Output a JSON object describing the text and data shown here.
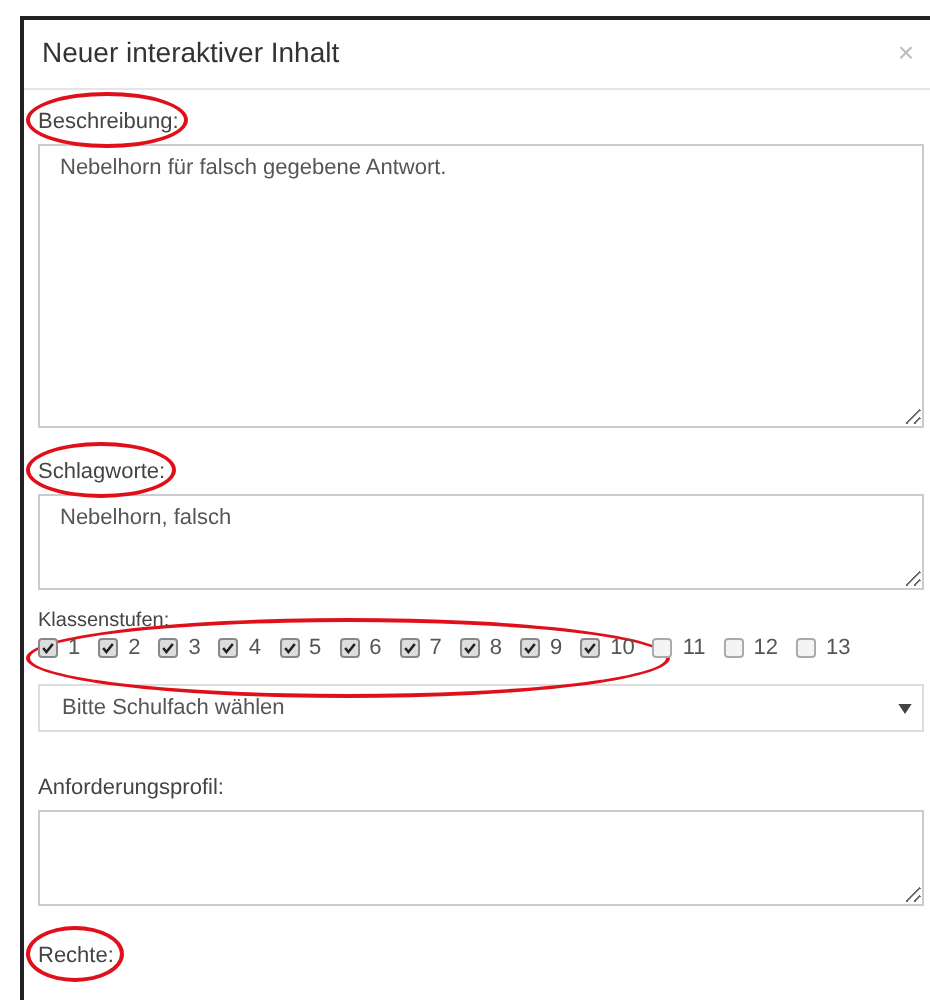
{
  "dialog": {
    "title": "Neuer interaktiver Inhalt",
    "close": "×"
  },
  "fields": [
    {
      "kind": "long-text",
      "label": "Beschreibung:",
      "circled": true,
      "value": "Nebelhorn für falsch gegebene Antwort."
    },
    {
      "kind": "text",
      "label": "Schlagworte:",
      "circled": true,
      "value": "Nebelhorn, falsch"
    },
    {
      "kind": "checkboxes",
      "label": "Klassenstufen:",
      "circled": true,
      "options": [
        {
          "label": "1",
          "checked": true
        },
        {
          "label": "2",
          "checked": true
        },
        {
          "label": "3",
          "checked": true
        },
        {
          "label": "4",
          "checked": true
        },
        {
          "label": "5",
          "checked": true
        },
        {
          "label": "6",
          "checked": true
        },
        {
          "label": "7",
          "checked": true
        },
        {
          "label": "8",
          "checked": true
        },
        {
          "label": "9",
          "checked": true
        },
        {
          "label": "10",
          "checked": true
        },
        {
          "label": "11",
          "checked": false
        },
        {
          "label": "12",
          "checked": false
        },
        {
          "label": "13",
          "checked": false
        }
      ]
    },
    {
      "kind": "select",
      "placeholder": "Bitte Schulfach wählen"
    },
    {
      "kind": "text",
      "label": "Anforderungsprofil:",
      "circled": false
    },
    {
      "kind": "heading",
      "label": "Rechte:",
      "circled": true
    }
  ]
}
